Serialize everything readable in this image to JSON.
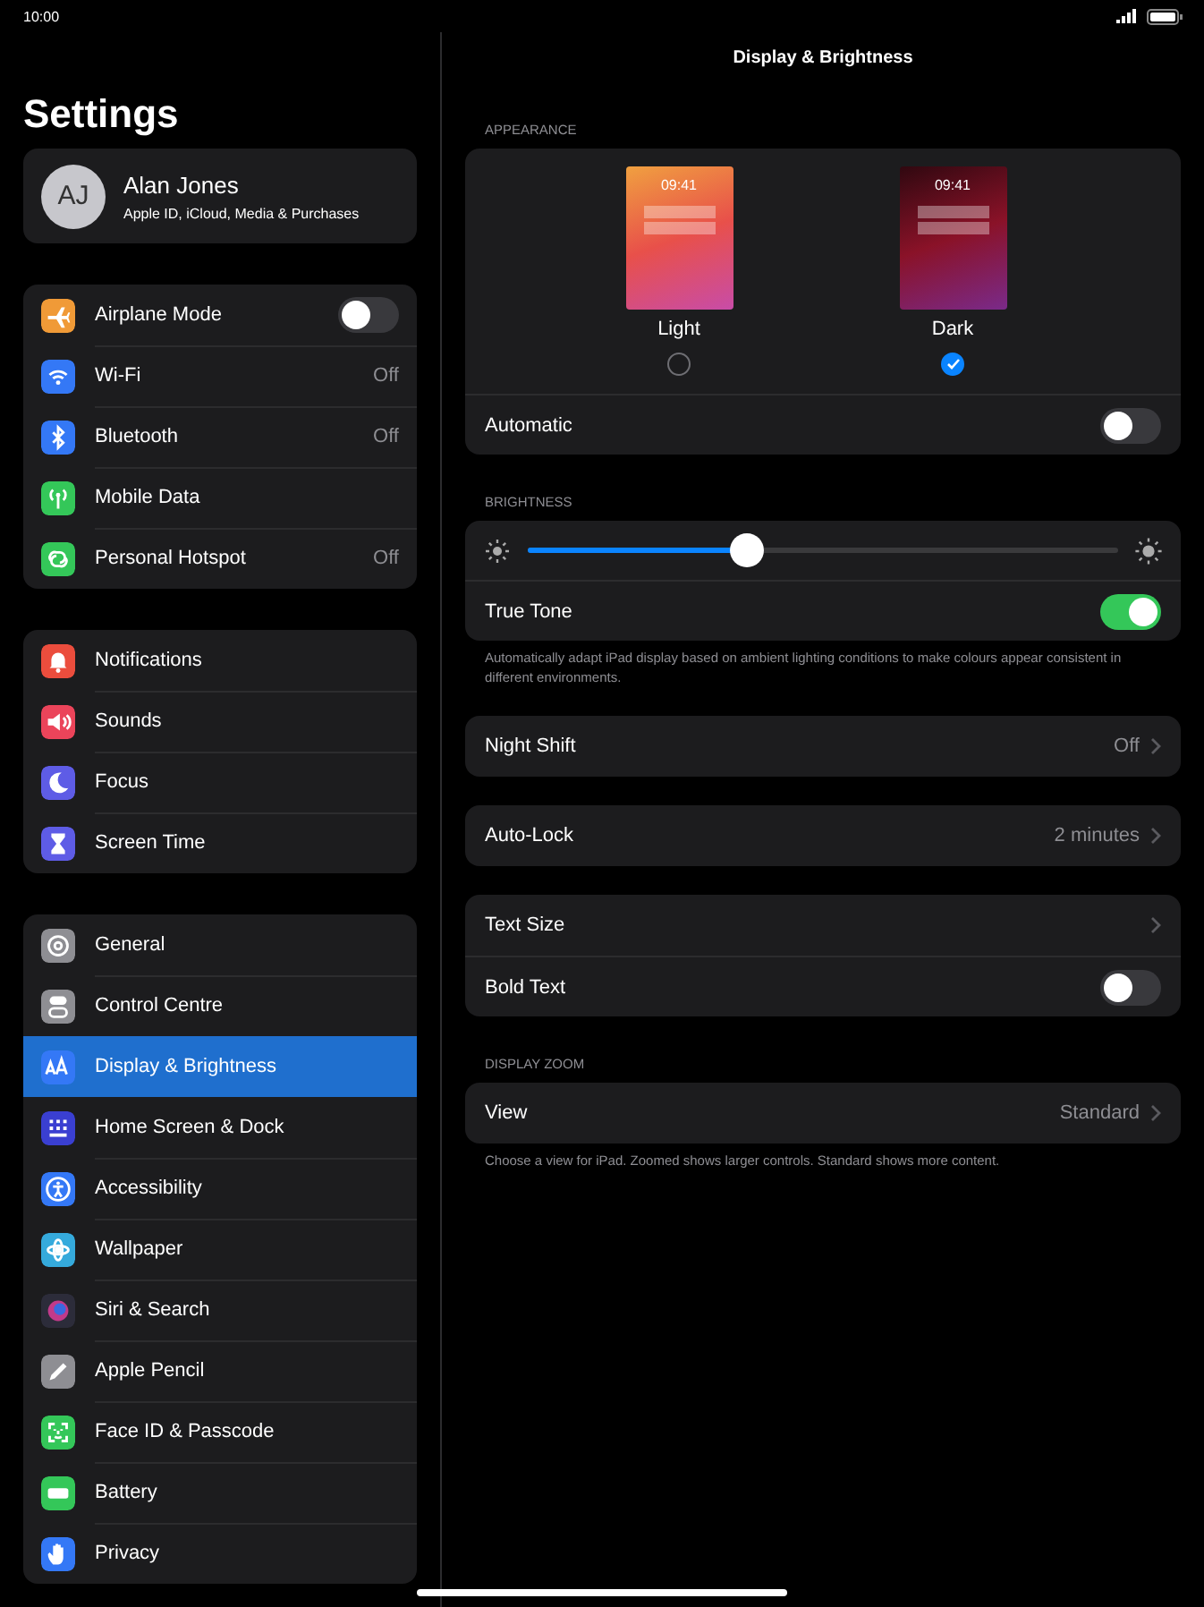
{
  "status_bar": {
    "time": "10:00"
  },
  "sidebar": {
    "title": "Settings",
    "profile": {
      "initials": "AJ",
      "name": "Alan Jones",
      "subtitle": "Apple ID, iCloud, Media & Purchases"
    },
    "groups": [
      {
        "items": [
          {
            "label": "Airplane Mode",
            "kind": "toggle",
            "on": false,
            "selected": false,
            "color": "#f09a37"
          },
          {
            "label": "Wi-Fi",
            "kind": "value",
            "value": "Off",
            "selected": false,
            "color": "#3478f6"
          },
          {
            "label": "Bluetooth",
            "kind": "value",
            "value": "Off",
            "selected": false,
            "color": "#3478f6"
          },
          {
            "label": "Mobile Data",
            "kind": "link",
            "selected": false,
            "color": "#34c759"
          },
          {
            "label": "Personal Hotspot",
            "kind": "value",
            "value": "Off",
            "selected": false,
            "color": "#34c759"
          }
        ]
      },
      {
        "items": [
          {
            "label": "Notifications",
            "kind": "link",
            "selected": false,
            "color": "#eb4d3d"
          },
          {
            "label": "Sounds",
            "kind": "link",
            "selected": false,
            "color": "#eb445a"
          },
          {
            "label": "Focus",
            "kind": "link",
            "selected": false,
            "color": "#5e5ce6"
          },
          {
            "label": "Screen Time",
            "kind": "link",
            "selected": false,
            "color": "#5e5ce6"
          }
        ]
      },
      {
        "items": [
          {
            "label": "General",
            "kind": "link",
            "selected": false,
            "color": "#8e8e93"
          },
          {
            "label": "Control Centre",
            "kind": "link",
            "selected": false,
            "color": "#8e8e93"
          },
          {
            "label": "Display & Brightness",
            "kind": "link",
            "selected": true,
            "color": "#3478f6"
          },
          {
            "label": "Home Screen & Dock",
            "kind": "link",
            "selected": false,
            "color": "#3a3fd1"
          },
          {
            "label": "Accessibility",
            "kind": "link",
            "selected": false,
            "color": "#3478f6"
          },
          {
            "label": "Wallpaper",
            "kind": "link",
            "selected": false,
            "color": "#35aadc"
          },
          {
            "label": "Siri & Search",
            "kind": "link",
            "selected": false,
            "color": "#2c2c3a"
          },
          {
            "label": "Apple Pencil",
            "kind": "link",
            "selected": false,
            "color": "#8e8e93"
          },
          {
            "label": "Face ID & Passcode",
            "kind": "link",
            "selected": false,
            "color": "#34c759"
          },
          {
            "label": "Battery",
            "kind": "link",
            "selected": false,
            "color": "#34c759"
          },
          {
            "label": "Privacy",
            "kind": "link",
            "selected": false,
            "color": "#3478f6"
          }
        ]
      }
    ]
  },
  "detail": {
    "title": "Display & Brightness",
    "appearance": {
      "header": "APPEARANCE",
      "options": [
        {
          "kind": "light",
          "time": "09:41",
          "label": "Light",
          "selected": false
        },
        {
          "kind": "dark",
          "time": "09:41",
          "label": "Dark",
          "selected": true
        }
      ],
      "automatic": {
        "label": "Automatic",
        "on": false
      }
    },
    "brightness": {
      "header": "BRIGHTNESS",
      "level": 0.37,
      "true_tone": {
        "label": "True Tone",
        "on": true
      },
      "footer": "Automatically adapt iPad display based on ambient lighting conditions to make colours appear consistent in different environments."
    },
    "groups": [
      {
        "rows": [
          {
            "kind": "link",
            "label": "Night Shift",
            "value": "Off"
          }
        ]
      },
      {
        "rows": [
          {
            "kind": "link",
            "label": "Auto-Lock",
            "value": "2 minutes"
          }
        ]
      },
      {
        "rows": [
          {
            "kind": "link",
            "label": "Text Size"
          },
          {
            "kind": "toggle",
            "label": "Bold Text",
            "on": false
          }
        ]
      },
      {
        "header": "DISPLAY ZOOM",
        "rows": [
          {
            "kind": "link",
            "label": "View",
            "value": "Standard"
          }
        ],
        "footer": "Choose a view for iPad. Zoomed shows larger controls. Standard shows more content."
      }
    ]
  }
}
